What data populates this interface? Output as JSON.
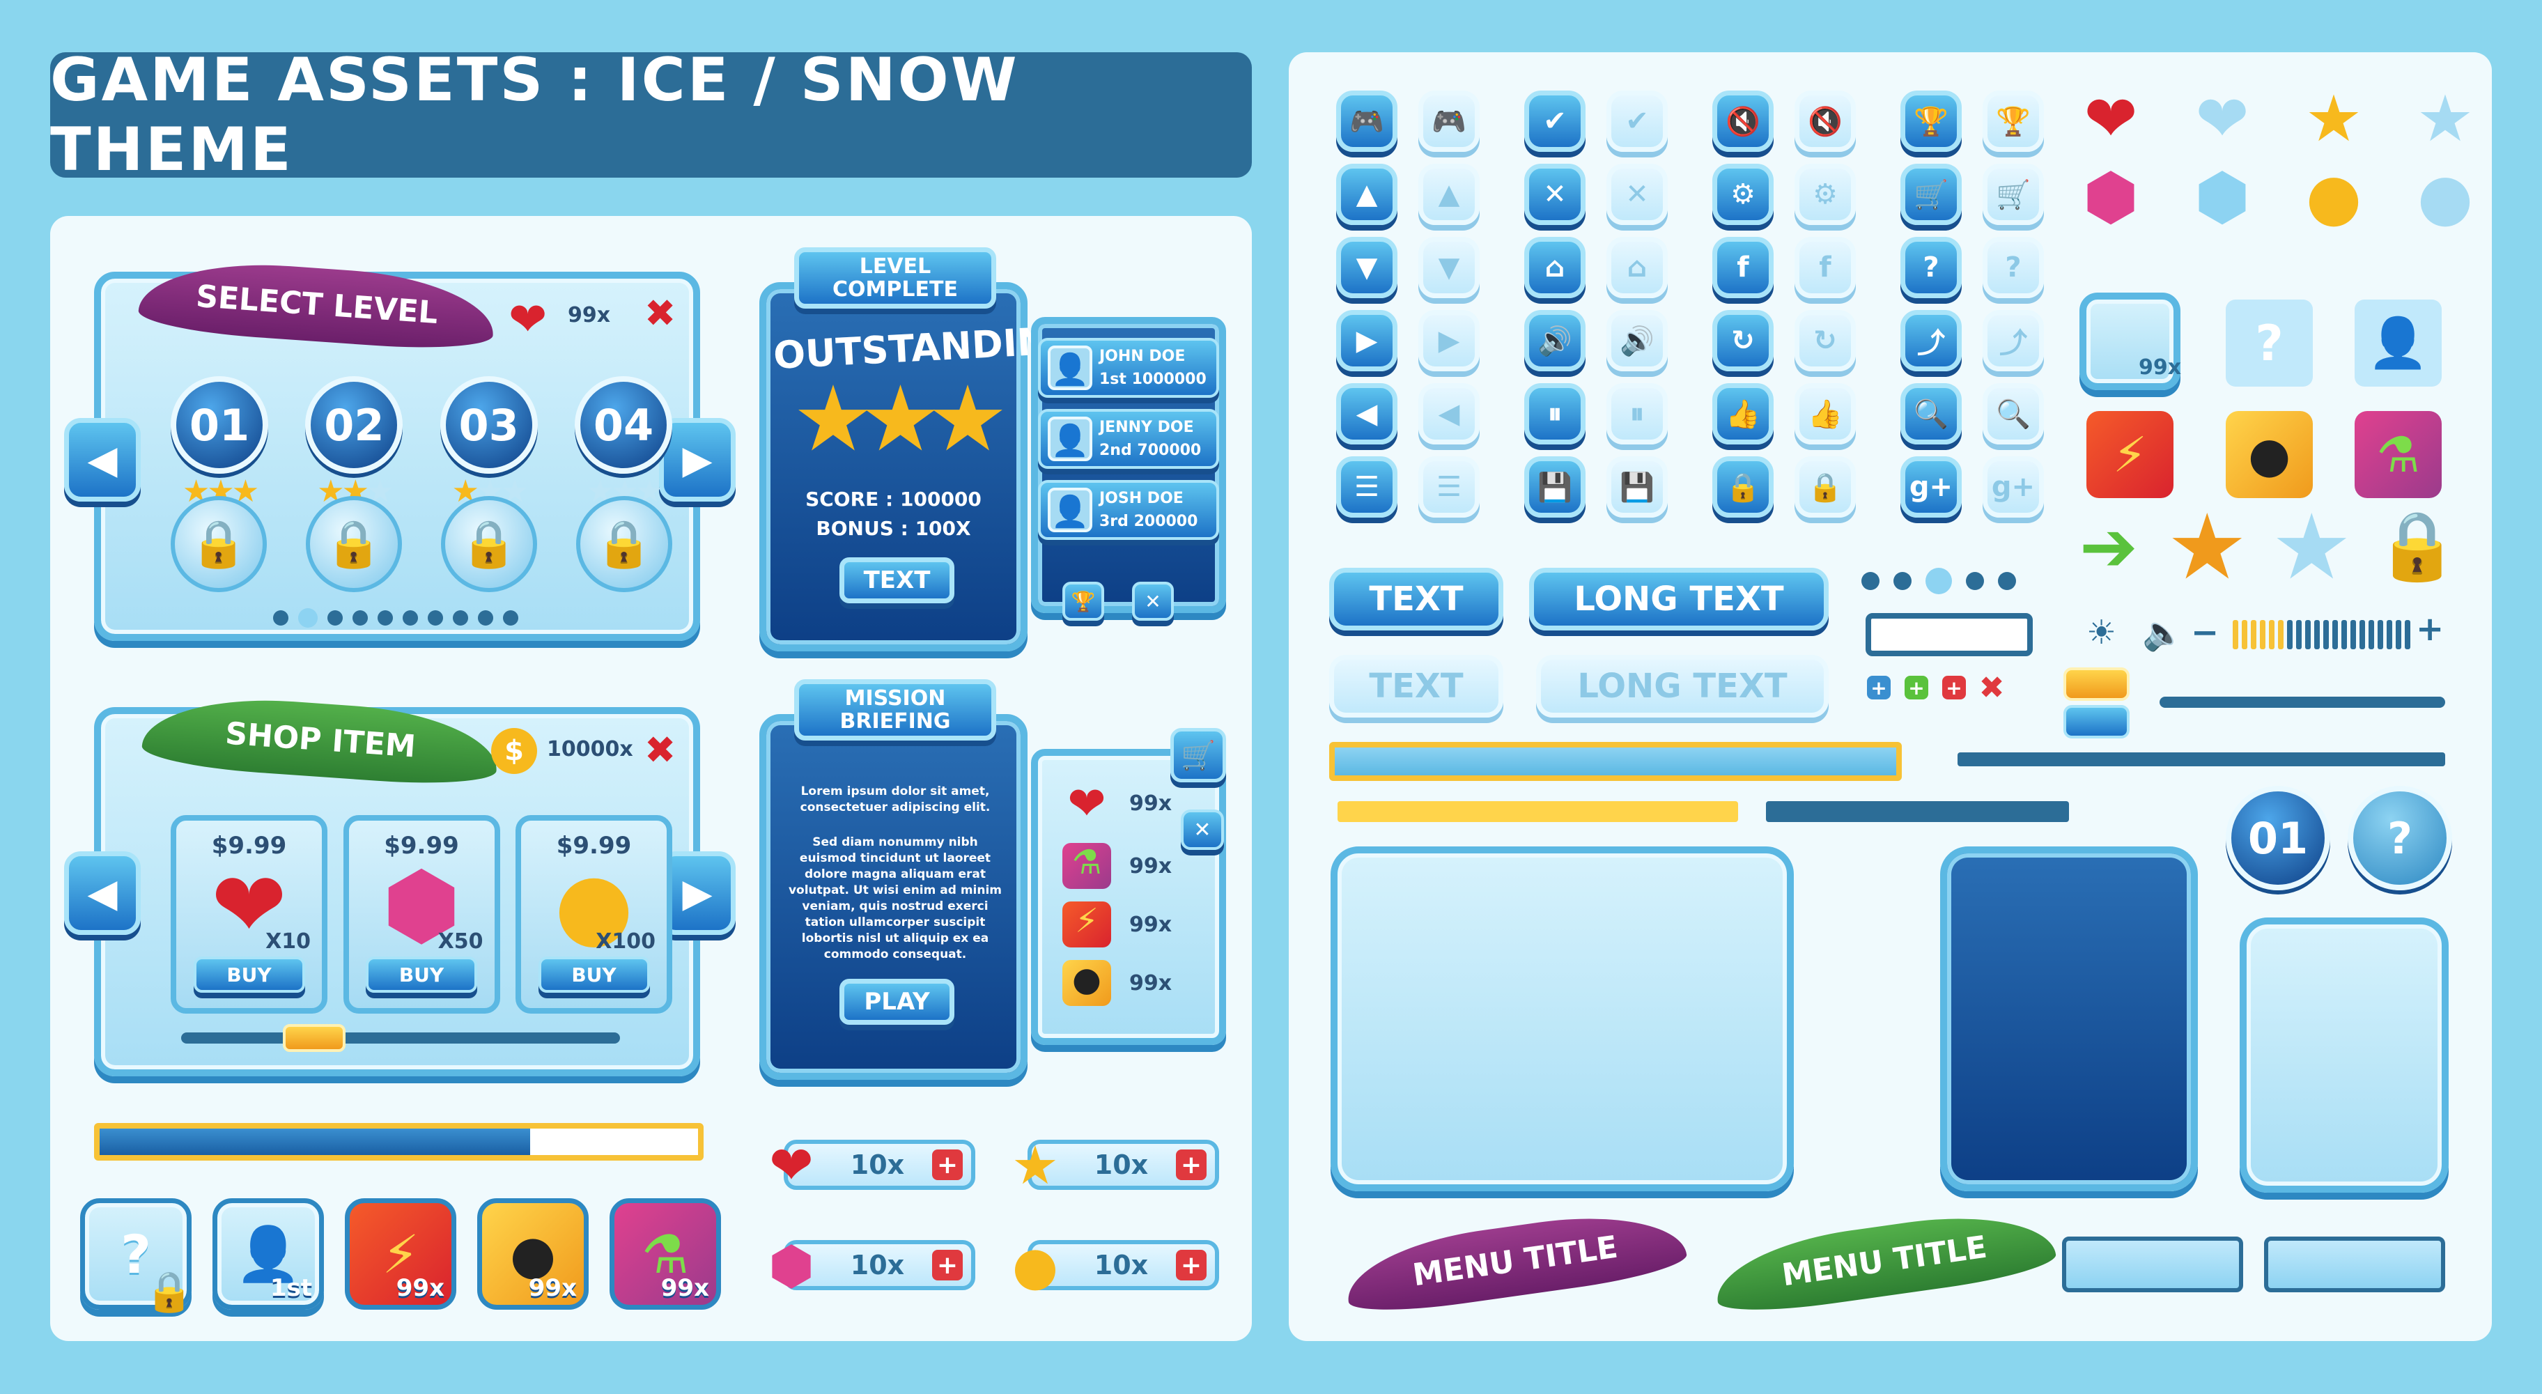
{
  "header": {
    "title": "GAME ASSETS : ICE / SNOW THEME"
  },
  "select_level": {
    "ribbon": "SELECT LEVEL",
    "lives": "99x",
    "levels": [
      {
        "num": "01",
        "stars": 3
      },
      {
        "num": "02",
        "stars": 2
      },
      {
        "num": "03",
        "stars": 1
      },
      {
        "num": "04",
        "stars": 0
      }
    ]
  },
  "level_complete": {
    "header": "LEVEL COMPLETE",
    "headline": "OUTSTANDING!",
    "score": "SCORE : 100000",
    "bonus": "BONUS : 100X",
    "button": "TEXT",
    "leaderboard": [
      {
        "name": "JOHN DOE",
        "rank": "1st",
        "score": "1000000"
      },
      {
        "name": "JENNY DOE",
        "rank": "2nd",
        "score": "700000"
      },
      {
        "name": "JOSH DOE",
        "rank": "3rd",
        "score": "200000"
      }
    ]
  },
  "shop": {
    "ribbon": "SHOP ITEM",
    "coins": "10000x",
    "items": [
      {
        "price": "$9.99",
        "qty": "X10",
        "buy": "BUY",
        "icon": "heart-icon",
        "glyph": "❤",
        "color": "#d9232e"
      },
      {
        "price": "$9.99",
        "qty": "X50",
        "buy": "BUY",
        "icon": "gem-icon",
        "glyph": "⬢",
        "color": "#e0418f"
      },
      {
        "price": "$9.99",
        "qty": "X100",
        "buy": "BUY",
        "icon": "coin-icon",
        "glyph": "●",
        "color": "#f7b91d"
      }
    ],
    "scroll_position": 0.27
  },
  "mission": {
    "header": "MISSION BRIEFING",
    "body1": "Lorem ipsum dolor sit amet, consectetuer adipiscing elit.",
    "body2": "Sed diam nonummy nibh euismod tincidunt ut laoreet dolore magna aliquam erat volutpat. Ut wisi enim ad minim veniam, quis nostrud exerci tation ullamcorper suscipit lobortis nisl ut aliquip ex ea commodo consequat.",
    "button": "PLAY",
    "inventory": [
      {
        "icon": "heart-icon",
        "qty": "99x"
      },
      {
        "icon": "potion-icon",
        "qty": "99x"
      },
      {
        "icon": "lightning-icon",
        "qty": "99x"
      },
      {
        "icon": "bomb-icon",
        "qty": "99x"
      }
    ]
  },
  "progress_left": {
    "value": 0.72
  },
  "bottom_items": [
    {
      "icon": "question-icon",
      "badge": ""
    },
    {
      "icon": "user-icon",
      "badge": "1st"
    },
    {
      "icon": "lightning-icon",
      "badge": "99x"
    },
    {
      "icon": "bomb-icon",
      "badge": "99x"
    },
    {
      "icon": "potion-icon",
      "badge": "99x"
    }
  ],
  "resources": [
    {
      "icon": "heart-icon",
      "value": "10x"
    },
    {
      "icon": "star-icon",
      "value": "10x"
    },
    {
      "icon": "gem-icon",
      "value": "10x"
    },
    {
      "icon": "coin-icon",
      "value": "10x"
    }
  ],
  "icon_buttons": [
    [
      "gamepad-icon",
      "check-icon",
      "mute-icon",
      "trophy-icon"
    ],
    [
      "up-icon",
      "close-icon",
      "settings-icon",
      "cart-icon"
    ],
    [
      "down-icon",
      "home-icon",
      "facebook-icon",
      "help-icon"
    ],
    [
      "play-icon",
      "sound-icon",
      "refresh-icon",
      "share-icon"
    ],
    [
      "back-icon",
      "pause-icon",
      "like-icon",
      "search-icon"
    ],
    [
      "menu-icon",
      "save-icon",
      "lock-icon",
      "google-plus-icon"
    ]
  ],
  "buttons": {
    "text": "TEXT",
    "long_text": "LONG TEXT"
  },
  "inventory_slot": {
    "badge": "99x"
  },
  "volume": {
    "value": 0.3
  },
  "round_buttons": {
    "level": "01",
    "help": "?"
  },
  "menu_titles": [
    "MENU TITLE",
    "MENU TITLE"
  ]
}
